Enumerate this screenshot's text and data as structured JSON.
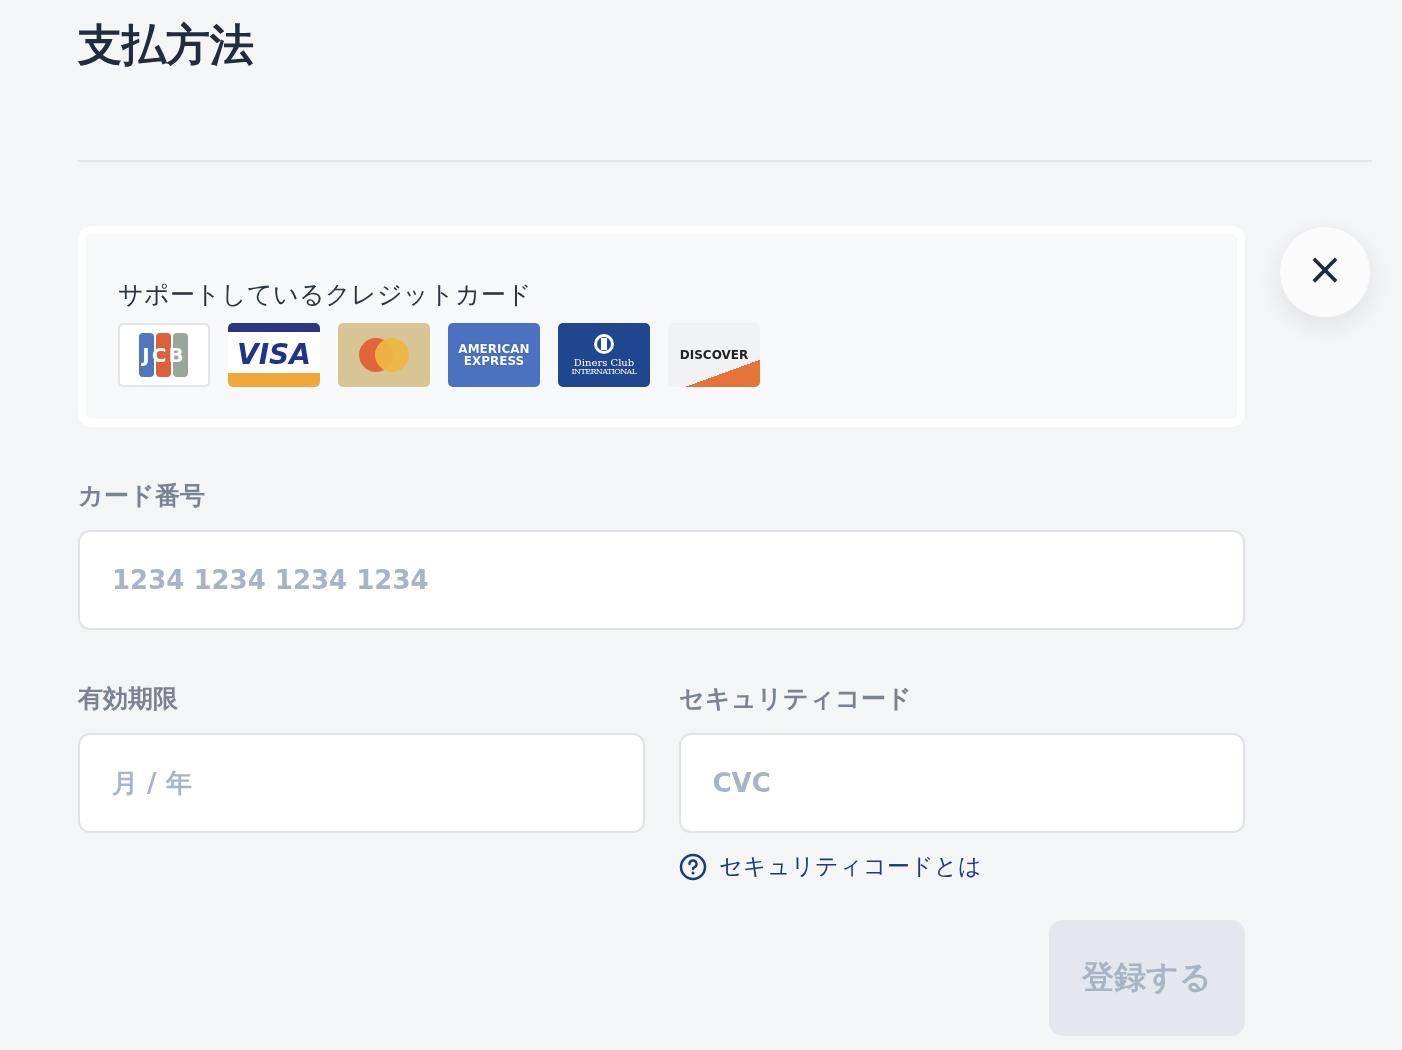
{
  "title": "支払方法",
  "close_button": {
    "label": "×"
  },
  "supported_cards": {
    "heading": "サポートしているクレジットカード",
    "cards": [
      {
        "kind": "jcb",
        "lines": [
          "JCB"
        ]
      },
      {
        "kind": "visa",
        "lines": [
          "VISA"
        ]
      },
      {
        "kind": "mastercard"
      },
      {
        "kind": "amex",
        "lines": [
          "AMERICAN",
          "EXPRESS"
        ]
      },
      {
        "kind": "diners",
        "lines": [
          "Diners Club",
          "INTERNATIONAL"
        ]
      },
      {
        "kind": "discover",
        "lines": [
          "DISCOVER"
        ]
      }
    ]
  },
  "card_number": {
    "label": "カード番号",
    "placeholder": "1234 1234 1234 1234"
  },
  "expiry": {
    "label": "有効期限",
    "placeholder": "月 / 年"
  },
  "security_code": {
    "label": "セキュリティコード",
    "placeholder": "CVC",
    "help_link": "セキュリティコードとは"
  },
  "submit_button": {
    "label": "登録する",
    "disabled": true
  }
}
